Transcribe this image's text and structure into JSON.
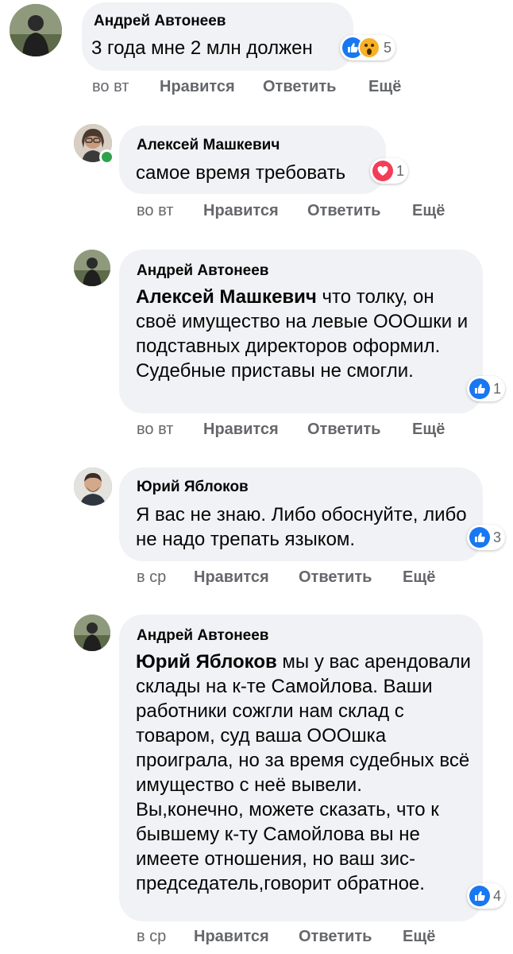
{
  "comments": [
    {
      "author": "Андрей Автонеев",
      "text": "3 года мне 2 млн должен",
      "reaction_count": "5",
      "time": "во вт",
      "like": "Нравится",
      "reply": "Ответить",
      "more": "Ещё"
    },
    {
      "author": "Алексей Машкевич",
      "text": "самое время требовать",
      "reaction_count": "1",
      "time": "во вт",
      "like": "Нравится",
      "reply": "Ответить",
      "more": "Ещё"
    },
    {
      "author": "Андрей Автонеев",
      "mention": "Алексей Машкевич",
      "text": " что толку, он своё имущество на левые ОООшки и подставных директоров оформил. Судебные приставы не смогли.",
      "reaction_count": "1",
      "time": "во вт",
      "like": "Нравится",
      "reply": "Ответить",
      "more": "Ещё"
    },
    {
      "author": "Юрий Яблоков",
      "text": "Я вас не знаю. Либо обоснуйте, либо не надо трепать языком.",
      "reaction_count": "3",
      "time": "в ср",
      "like": "Нравится",
      "reply": "Ответить",
      "more": "Ещё"
    },
    {
      "author": "Андрей Автонеев",
      "mention": "Юрий Яблоков",
      "text": " мы у вас арендовали склады на к-те Самойлова. Ваши работники сожгли нам склад с товаром, суд ваша ОООшка проиграла, но за время судебных всё имущество с неё вывели. Вы,конечно, можете сказать, что к бывшему к-ту Самойлова вы не имеете отношения, но ваш зис-председатель,говорит обратное.",
      "reaction_count": "4",
      "time": "в ср",
      "like": "Нравится",
      "reply": "Ответить",
      "more": "Ещё"
    }
  ],
  "colors": {
    "bubble": "#f0f2f5",
    "meta": "#65676b",
    "like_reaction": "#1877f2",
    "love_reaction": "#f33e58",
    "wow_reaction": "#f7b125",
    "online": "#31a24c"
  }
}
